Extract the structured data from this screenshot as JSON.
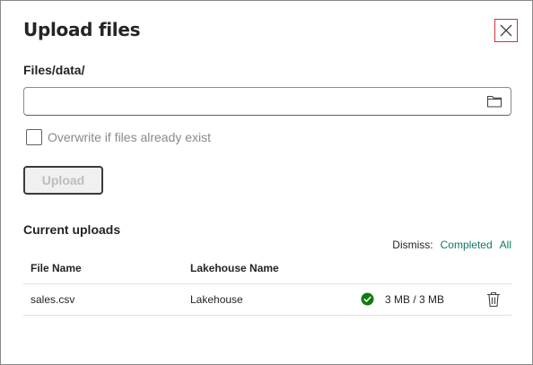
{
  "dialog": {
    "title": "Upload files",
    "close_icon": "close-icon"
  },
  "destination": {
    "path_label": "Files/data/",
    "file_input_value": "",
    "file_input_placeholder": "",
    "browse_icon": "folder-icon"
  },
  "overwrite": {
    "label": "Overwrite if files already exist",
    "checked": false
  },
  "upload_button": {
    "label": "Upload",
    "enabled": false
  },
  "current_uploads": {
    "title": "Current uploads",
    "dismiss_label": "Dismiss:",
    "dismiss_completed": "Completed",
    "dismiss_all": "All",
    "columns": [
      "File Name",
      "Lakehouse Name"
    ],
    "rows": [
      {
        "file_name": "sales.csv",
        "lakehouse": "Lakehouse",
        "status_icon": "check-circle-icon",
        "progress": "3 MB / 3 MB",
        "delete_icon": "trash-icon"
      }
    ]
  },
  "colors": {
    "accent": "#117865",
    "success": "#107c10",
    "close_highlight": "#d13438"
  }
}
